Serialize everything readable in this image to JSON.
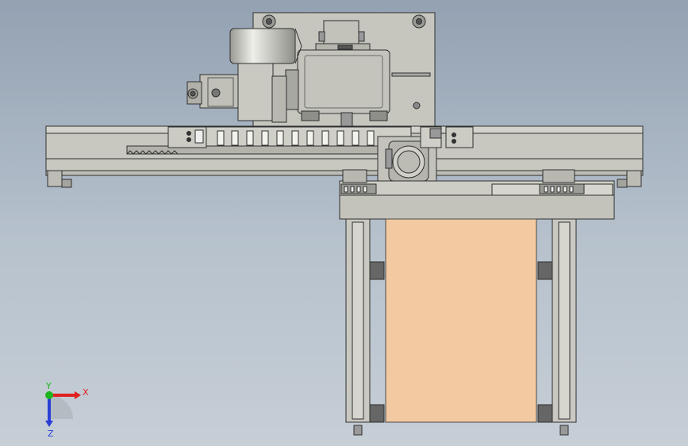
{
  "viewport": {
    "background_top": "#93a1b2",
    "background_bottom": "#c6ced6",
    "part_color": "#c9c9c2",
    "edge_color": "#2f2f2f",
    "plate_color": "#f2c9a0"
  },
  "triad": {
    "x_label": "X",
    "y_label": "Y",
    "z_label": "Z",
    "x_color": "#e02020",
    "y_color": "#1fb51f",
    "z_color": "#2a3fd6"
  }
}
